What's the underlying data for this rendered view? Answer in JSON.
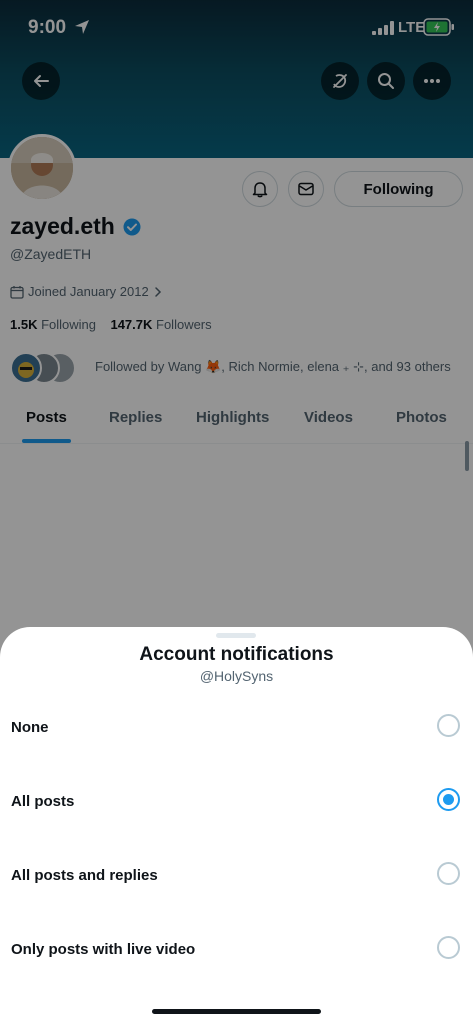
{
  "status_bar": {
    "time": "9:00",
    "network": "LTE"
  },
  "profile": {
    "name": "zayed.eth",
    "handle": "@ZayedETH",
    "joined": "Joined January 2012",
    "following_count": "1.5K",
    "following_label": "Following",
    "followers_count": "147.7K",
    "followers_label": "Followers",
    "followed_by": "Followed by Wang 🦊, Rich Normie, elena ₊ ⊹, and 93 others",
    "follow_button_label": "Following"
  },
  "tabs": [
    {
      "label": "Posts",
      "active": true
    },
    {
      "label": "Replies"
    },
    {
      "label": "Highlights"
    },
    {
      "label": "Videos"
    },
    {
      "label": "Photos"
    }
  ],
  "sheet": {
    "title": "Account notifications",
    "subtitle": "@HolySyns",
    "options": [
      {
        "label": "None",
        "selected": false
      },
      {
        "label": "All posts",
        "selected": true
      },
      {
        "label": "All posts and replies",
        "selected": false
      },
      {
        "label": "Only posts with live video",
        "selected": false
      }
    ]
  },
  "colors": {
    "accent": "#1d9bf0",
    "banner": "#0a6581",
    "text": "#0f1419",
    "secondary": "#536471"
  },
  "icons": [
    "back-arrow-icon",
    "unmute-icon",
    "search-icon",
    "more-icon",
    "bell-icon",
    "mail-icon",
    "verified-badge-icon",
    "calendar-icon",
    "chevron-right-icon",
    "location-arrow-icon",
    "signal-icon",
    "battery-icon"
  ]
}
